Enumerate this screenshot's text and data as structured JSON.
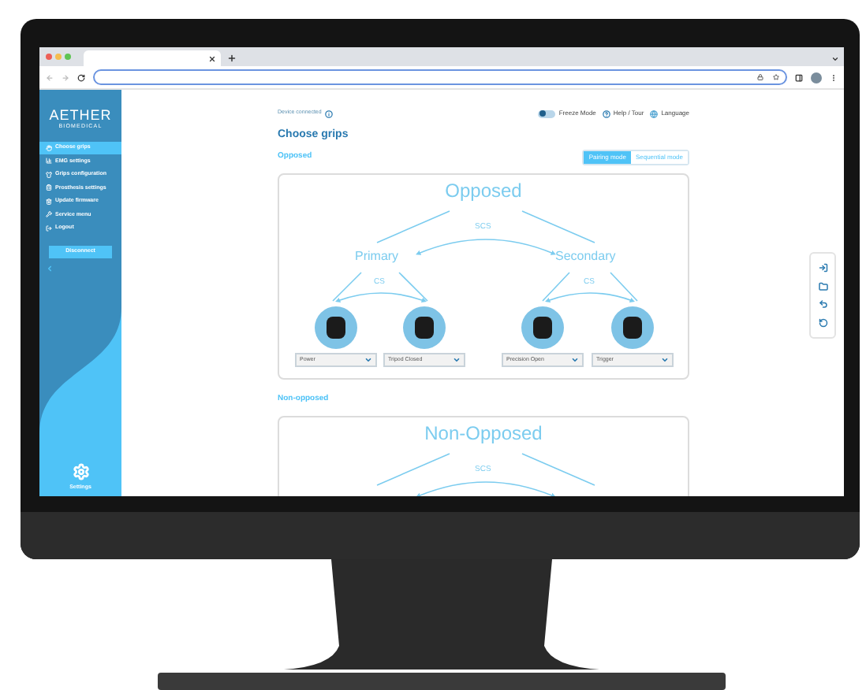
{
  "sidebar": {
    "logo": "AETHER",
    "logo_subtitle": "BIOMEDICAL",
    "items": [
      {
        "label": "Choose grips",
        "selected": true
      },
      {
        "label": "EMG settings",
        "selected": false
      },
      {
        "label": "Grips configuration",
        "selected": false
      },
      {
        "label": "Prosthesis settings",
        "selected": false
      },
      {
        "label": "Update firmware",
        "selected": false
      },
      {
        "label": "Service menu",
        "selected": false
      },
      {
        "label": "Logout",
        "selected": false
      }
    ],
    "disconnect": "Disconnect",
    "settings": "Settings"
  },
  "header": {
    "status": "Device connected",
    "freeze": {
      "label": "Freeze Mode",
      "on": false
    },
    "help": "Help / Tour",
    "language": "Language"
  },
  "title": "Choose grips",
  "sections": [
    {
      "heading": "Opposed",
      "modes": [
        {
          "label": "Pairing mode",
          "selected": true
        },
        {
          "label": "Sequential mode",
          "selected": false
        }
      ],
      "diagram": {
        "title": "Opposed",
        "link_label": "SCS",
        "branches": [
          {
            "label": "Primary",
            "link_label": "CS",
            "grips": [
              {
                "value": "Power"
              },
              {
                "value": "Tripod Closed"
              }
            ]
          },
          {
            "label": "Secondary",
            "link_label": "CS",
            "grips": [
              {
                "value": "Precision Open"
              },
              {
                "value": "Trigger"
              }
            ]
          }
        ]
      }
    },
    {
      "heading": "Non-opposed",
      "diagram": {
        "title": "Non-Opposed",
        "link_label": "SCS"
      }
    }
  ]
}
